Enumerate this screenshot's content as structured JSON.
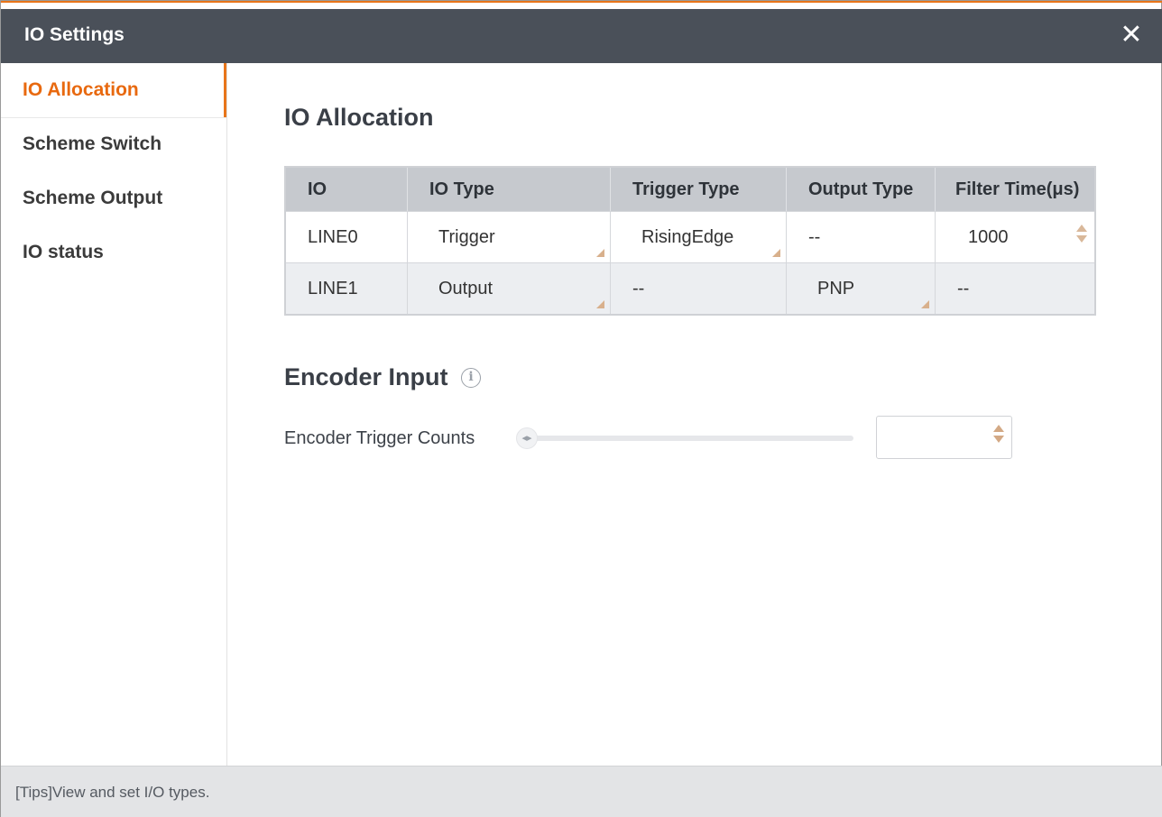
{
  "window": {
    "title": "IO Settings",
    "close_icon": "close-icon"
  },
  "sidebar": {
    "items": [
      {
        "label": "IO Allocation",
        "active": true
      },
      {
        "label": "Scheme Switch",
        "active": false
      },
      {
        "label": "Scheme Output",
        "active": false
      },
      {
        "label": "IO status",
        "active": false
      }
    ]
  },
  "io_allocation": {
    "heading": "IO Allocation",
    "columns": [
      "IO",
      "IO Type",
      "Trigger Type",
      "Output Type",
      "Filter Time(μs)"
    ],
    "rows": [
      {
        "io": "LINE0",
        "io_type": "Trigger",
        "trigger_type": "RisingEdge",
        "output_type": "--",
        "filter_time": "1000"
      },
      {
        "io": "LINE1",
        "io_type": "Output",
        "trigger_type": "--",
        "output_type": "PNP",
        "filter_time": "--"
      }
    ]
  },
  "encoder_input": {
    "heading": "Encoder Input",
    "info_icon": "info-icon",
    "trigger_counts_label": "Encoder Trigger Counts",
    "trigger_counts_value": ""
  },
  "footer": {
    "tips": "[Tips]View and set I/O types."
  },
  "colors": {
    "accent": "#e8751a",
    "titlebar": "#4a5059",
    "table_header": "#c6c9ce",
    "footer": "#e3e4e6"
  }
}
